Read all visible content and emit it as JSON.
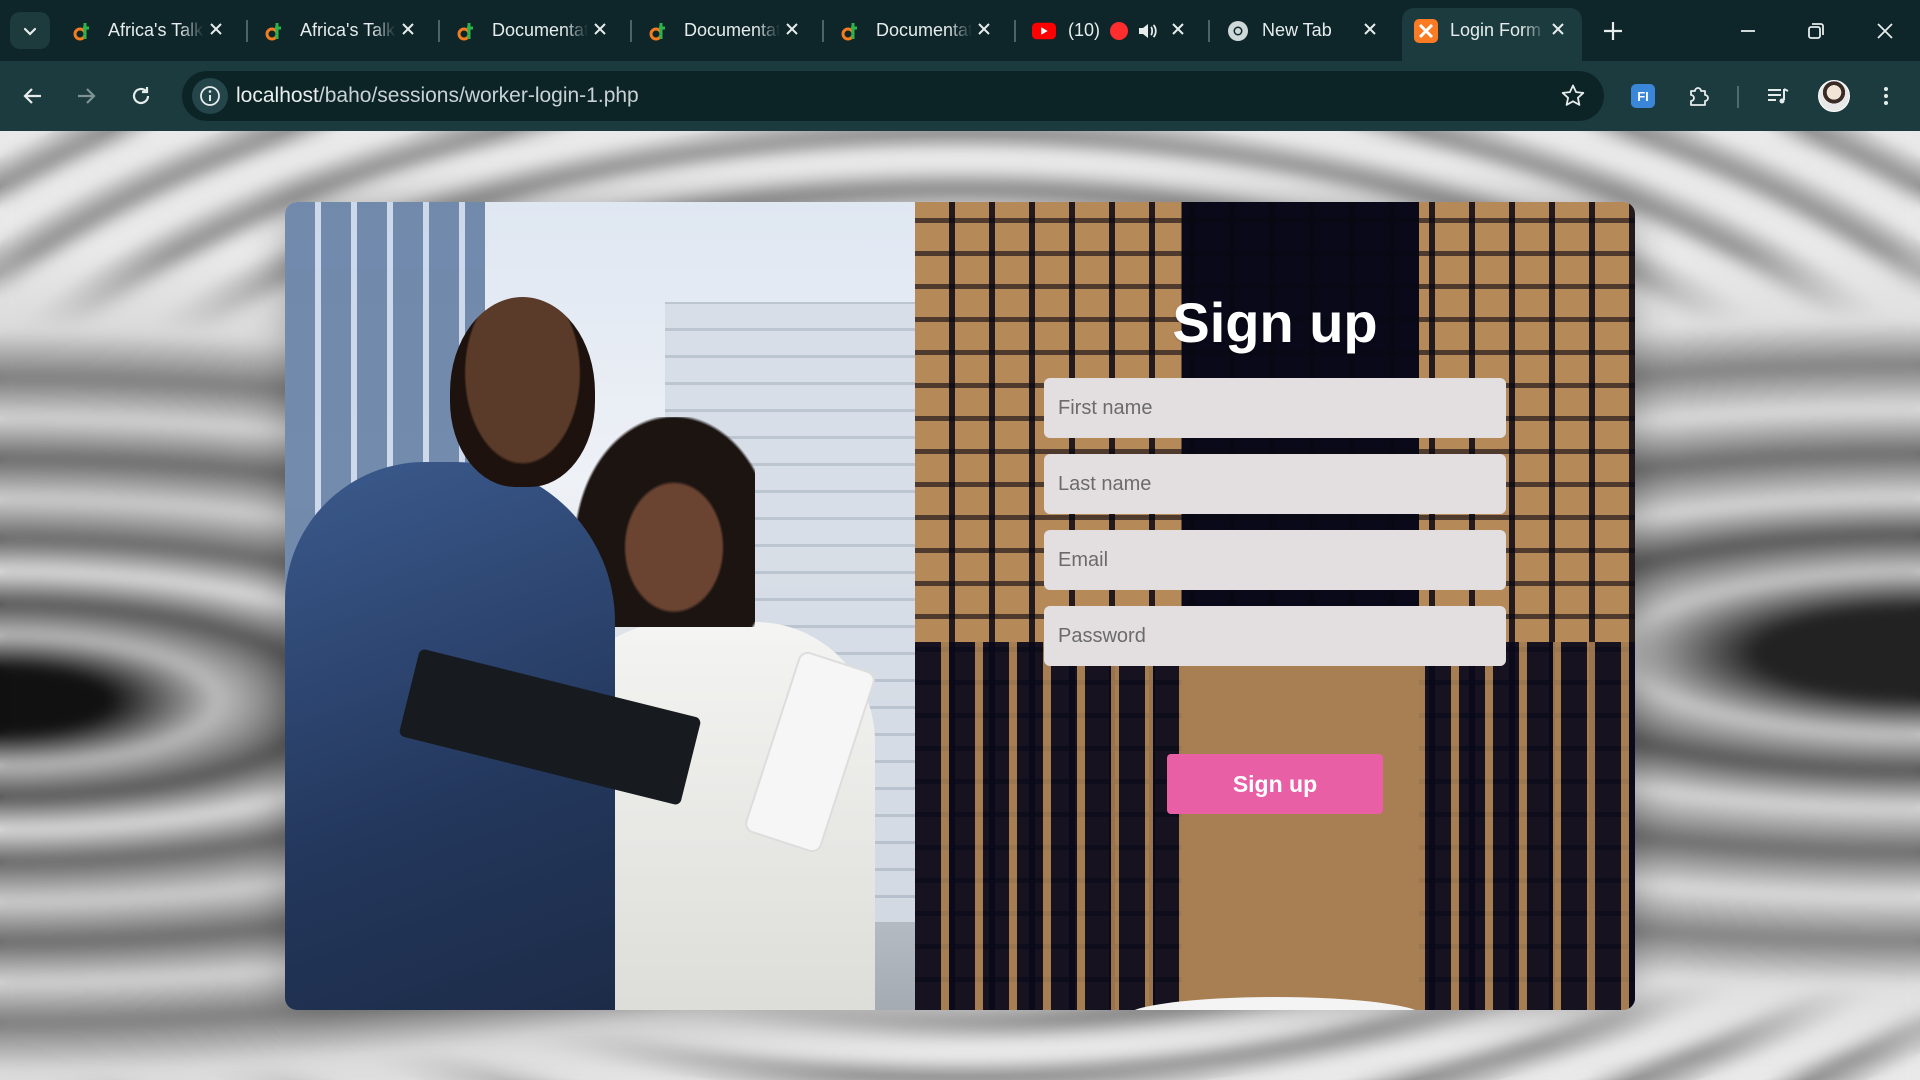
{
  "browser": {
    "tabs": [
      {
        "title": "Africa's Talking",
        "favicon": "africas-talking-icon",
        "active": false
      },
      {
        "title": "Africa's Talking",
        "favicon": "africas-talking-icon",
        "active": false
      },
      {
        "title": "Documentation",
        "favicon": "africas-talking-icon",
        "active": false
      },
      {
        "title": "Documentation",
        "favicon": "africas-talking-icon",
        "active": false
      },
      {
        "title": "Documentation",
        "favicon": "africas-talking-icon",
        "active": false
      },
      {
        "title": "(10)",
        "favicon": "youtube-icon",
        "active": false,
        "recording": true,
        "audio": true
      },
      {
        "title": "New Tab",
        "favicon": "chrome-icon",
        "active": false
      },
      {
        "title": "Login Form",
        "favicon": "xampp-icon",
        "active": true
      }
    ],
    "address_bar": {
      "host": "localhost",
      "path": "/baho/sessions/worker-login-1.php"
    },
    "colors": {
      "chrome_dark": "#0e2629",
      "toolbar": "#1c3b3f",
      "omnibox": "#0d2427"
    }
  },
  "page": {
    "title": "Sign up",
    "fields": {
      "first_name_placeholder": "First name",
      "last_name_placeholder": "Last name",
      "email_placeholder": "Email",
      "password_placeholder": "Password"
    },
    "submit_label": "Sign up",
    "colors": {
      "button": "#e95fa5",
      "field_bg": "#e3dfe0",
      "pattern_tan": "#c0915d",
      "pattern_navy": "#0a0a1c"
    }
  }
}
